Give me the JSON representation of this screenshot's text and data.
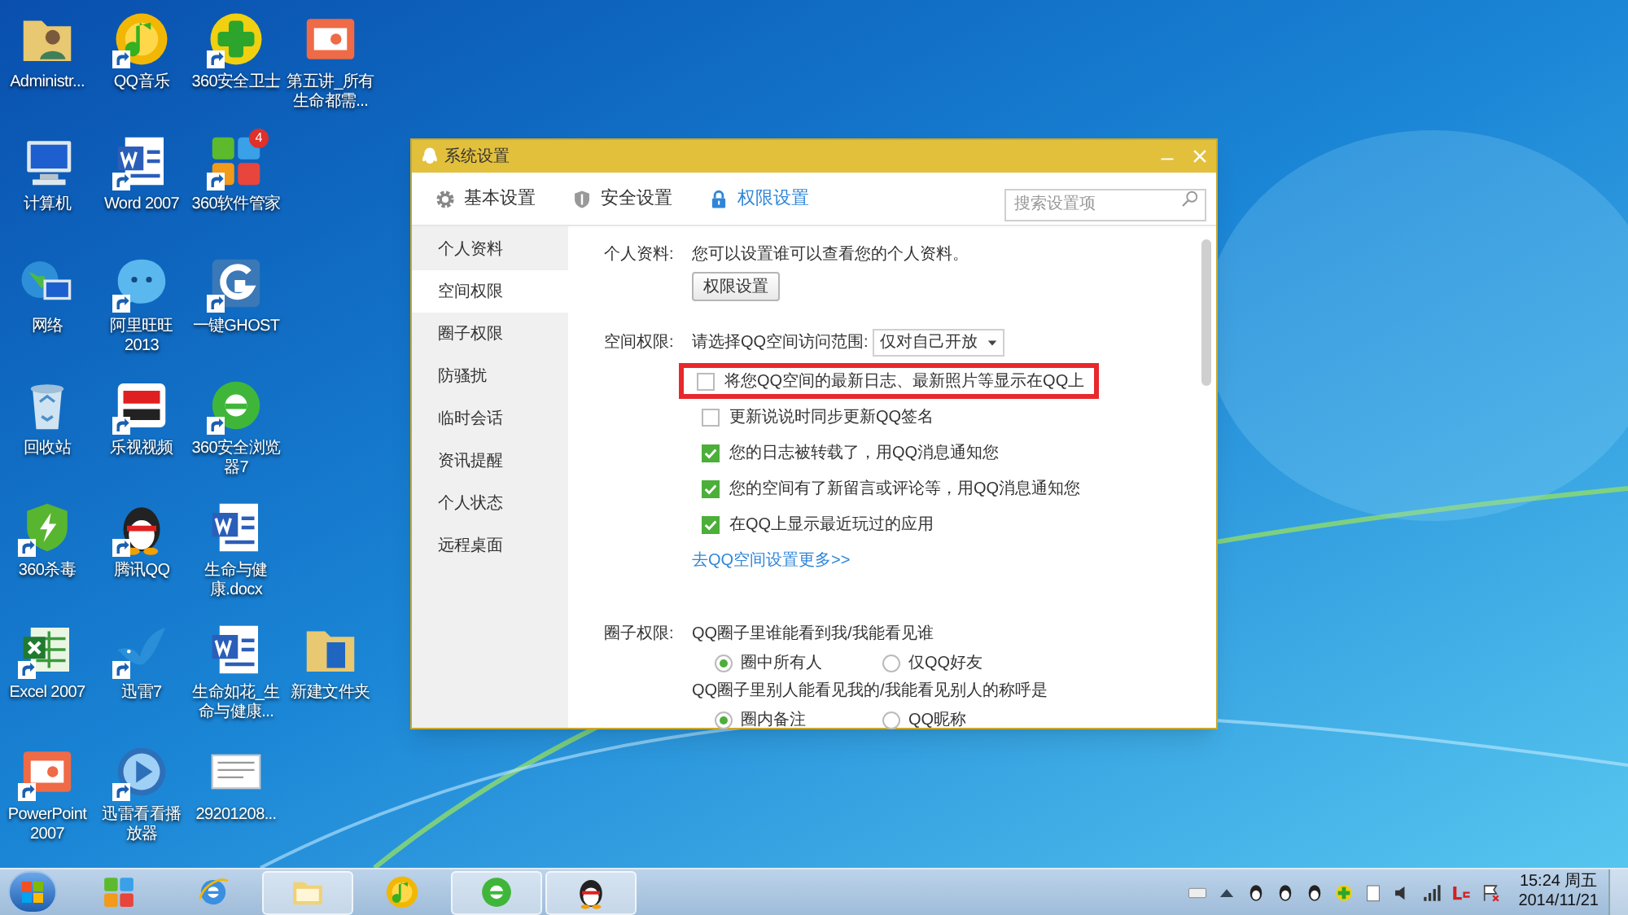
{
  "desktop_icons": [
    [
      {
        "label": "Administr...",
        "kind": "user-folder",
        "shortcut": false
      },
      {
        "label": "QQ音乐",
        "kind": "music",
        "shortcut": true
      },
      {
        "label": "360安全卫士",
        "kind": "plus",
        "shortcut": true
      },
      {
        "label": "第五讲_所有生命都需...",
        "kind": "slides",
        "shortcut": false
      }
    ],
    [
      {
        "label": "计算机",
        "kind": "computer",
        "shortcut": false
      },
      {
        "label": "Word 2007",
        "kind": "word",
        "shortcut": true
      },
      {
        "label": "360软件管家",
        "kind": "tiles",
        "shortcut": true,
        "badge": "4"
      }
    ],
    [
      {
        "label": "网络",
        "kind": "globe",
        "shortcut": false
      },
      {
        "label": "阿里旺旺 2013",
        "kind": "bubble",
        "shortcut": true
      },
      {
        "label": "一键GHOST",
        "kind": "ghost",
        "shortcut": true
      }
    ],
    [
      {
        "label": "回收站",
        "kind": "bin",
        "shortcut": false
      },
      {
        "label": "乐视视频",
        "kind": "tv",
        "shortcut": true
      },
      {
        "label": "360安全浏览器7",
        "kind": "browser",
        "shortcut": true
      }
    ],
    [
      {
        "label": "360杀毒",
        "kind": "shield",
        "shortcut": true
      },
      {
        "label": "腾讯QQ",
        "kind": "penguin",
        "shortcut": true
      },
      {
        "label": "生命与健康.docx",
        "kind": "word",
        "shortcut": false
      }
    ],
    [
      {
        "label": "Excel 2007",
        "kind": "excel",
        "shortcut": true
      },
      {
        "label": "迅雷7",
        "kind": "bird",
        "shortcut": true
      },
      {
        "label": "生命如花_生命与健康...",
        "kind": "word",
        "shortcut": false
      },
      {
        "label": "新建文件夹",
        "kind": "folder",
        "shortcut": false
      }
    ],
    [
      {
        "label": "PowerPoint 2007",
        "kind": "slides",
        "shortcut": true
      },
      {
        "label": "迅雷看看播放器",
        "kind": "player",
        "shortcut": true
      },
      {
        "label": "29201208...",
        "kind": "image",
        "shortcut": false
      }
    ]
  ],
  "dialog": {
    "title": "系统设置",
    "tabs": [
      {
        "label": "基本设置",
        "kind": "gear",
        "selected": false
      },
      {
        "label": "安全设置",
        "kind": "shield",
        "selected": false
      },
      {
        "label": "权限设置",
        "kind": "lock",
        "selected": true
      }
    ],
    "search": {
      "placeholder": "搜索设置项"
    },
    "sidebar": [
      {
        "label": "个人资料",
        "selected": false
      },
      {
        "label": "空间权限",
        "selected": true
      },
      {
        "label": "圈子权限",
        "selected": false
      },
      {
        "label": "防骚扰",
        "selected": false
      },
      {
        "label": "临时会话",
        "selected": false
      },
      {
        "label": "资讯提醒",
        "selected": false
      },
      {
        "label": "个人状态",
        "selected": false
      },
      {
        "label": "远程桌面",
        "selected": false
      }
    ],
    "profile": {
      "label": "个人资料:",
      "text": "您可以设置谁可以查看您的个人资料。",
      "button": "权限设置"
    },
    "space": {
      "label": "空间权限:",
      "prompt": "请选择QQ空间访问范围:",
      "dropdown": "仅对自己开放",
      "options": [
        {
          "label": "将您QQ空间的最新日志、最新照片等显示在QQ上",
          "checked": false,
          "highlighted": true
        },
        {
          "label": "更新说说时同步更新QQ签名",
          "checked": false,
          "highlighted": false
        },
        {
          "label": "您的日志被转载了，用QQ消息通知您",
          "checked": true,
          "highlighted": false
        },
        {
          "label": "您的空间有了新留言或评论等，用QQ消息通知您",
          "checked": true,
          "highlighted": false
        },
        {
          "label": "在QQ上显示最近玩过的应用",
          "checked": true,
          "highlighted": false
        }
      ],
      "link": "去QQ空间设置更多>>"
    },
    "circle": {
      "label": "圈子权限:",
      "groups": [
        {
          "question": "QQ圈子里谁能看到我/我能看见谁",
          "radios": [
            {
              "label": "圈中所有人",
              "selected": true
            },
            {
              "label": "仅QQ好友",
              "selected": false
            }
          ]
        },
        {
          "question": "QQ圈子里别人能看见我的/我能看见别人的称呼是",
          "radios": [
            {
              "label": "圈内备注",
              "selected": true
            },
            {
              "label": "QQ昵称",
              "selected": false
            }
          ]
        }
      ]
    }
  },
  "taskbar": {
    "buttons": [
      {
        "kind": "tiles",
        "active": false
      },
      {
        "kind": "ie",
        "active": false
      },
      {
        "kind": "explorer",
        "active": true
      },
      {
        "kind": "music",
        "active": false
      },
      {
        "kind": "browser",
        "active": true
      },
      {
        "kind": "penguin",
        "active": true
      }
    ],
    "time": "15:24 周五",
    "date": "2014/11/21"
  }
}
